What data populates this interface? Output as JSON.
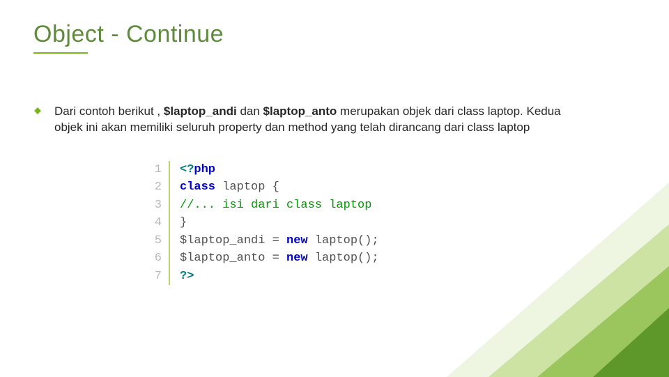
{
  "title": "Object - Continue",
  "bullet": {
    "pre": "Dari contoh berikut , ",
    "b1": "$laptop_andi",
    "mid": " dan ",
    "b2": "$laptop_anto",
    "post": " merupakan objek dari class laptop. Kedua objek ini akan memiliki seluruh property dan method yang telah dirancang dari class laptop"
  },
  "code": {
    "lines": [
      "1",
      "2",
      "3",
      "4",
      "5",
      "6",
      "7"
    ],
    "l1_open": "<?",
    "l1_php": "php",
    "l2_kw": "class",
    "l2_name": " laptop ",
    "l2_brace": "{",
    "l3": "//... isi dari class laptop",
    "l4": "}",
    "l5_var": "$laptop_andi",
    "l5_eq": " = ",
    "l5_new": "new",
    "l5_call": " laptop();",
    "l6_var": "$laptop_anto",
    "l6_eq": " = ",
    "l6_new": "new",
    "l6_call": " laptop();",
    "l7": "?>"
  }
}
